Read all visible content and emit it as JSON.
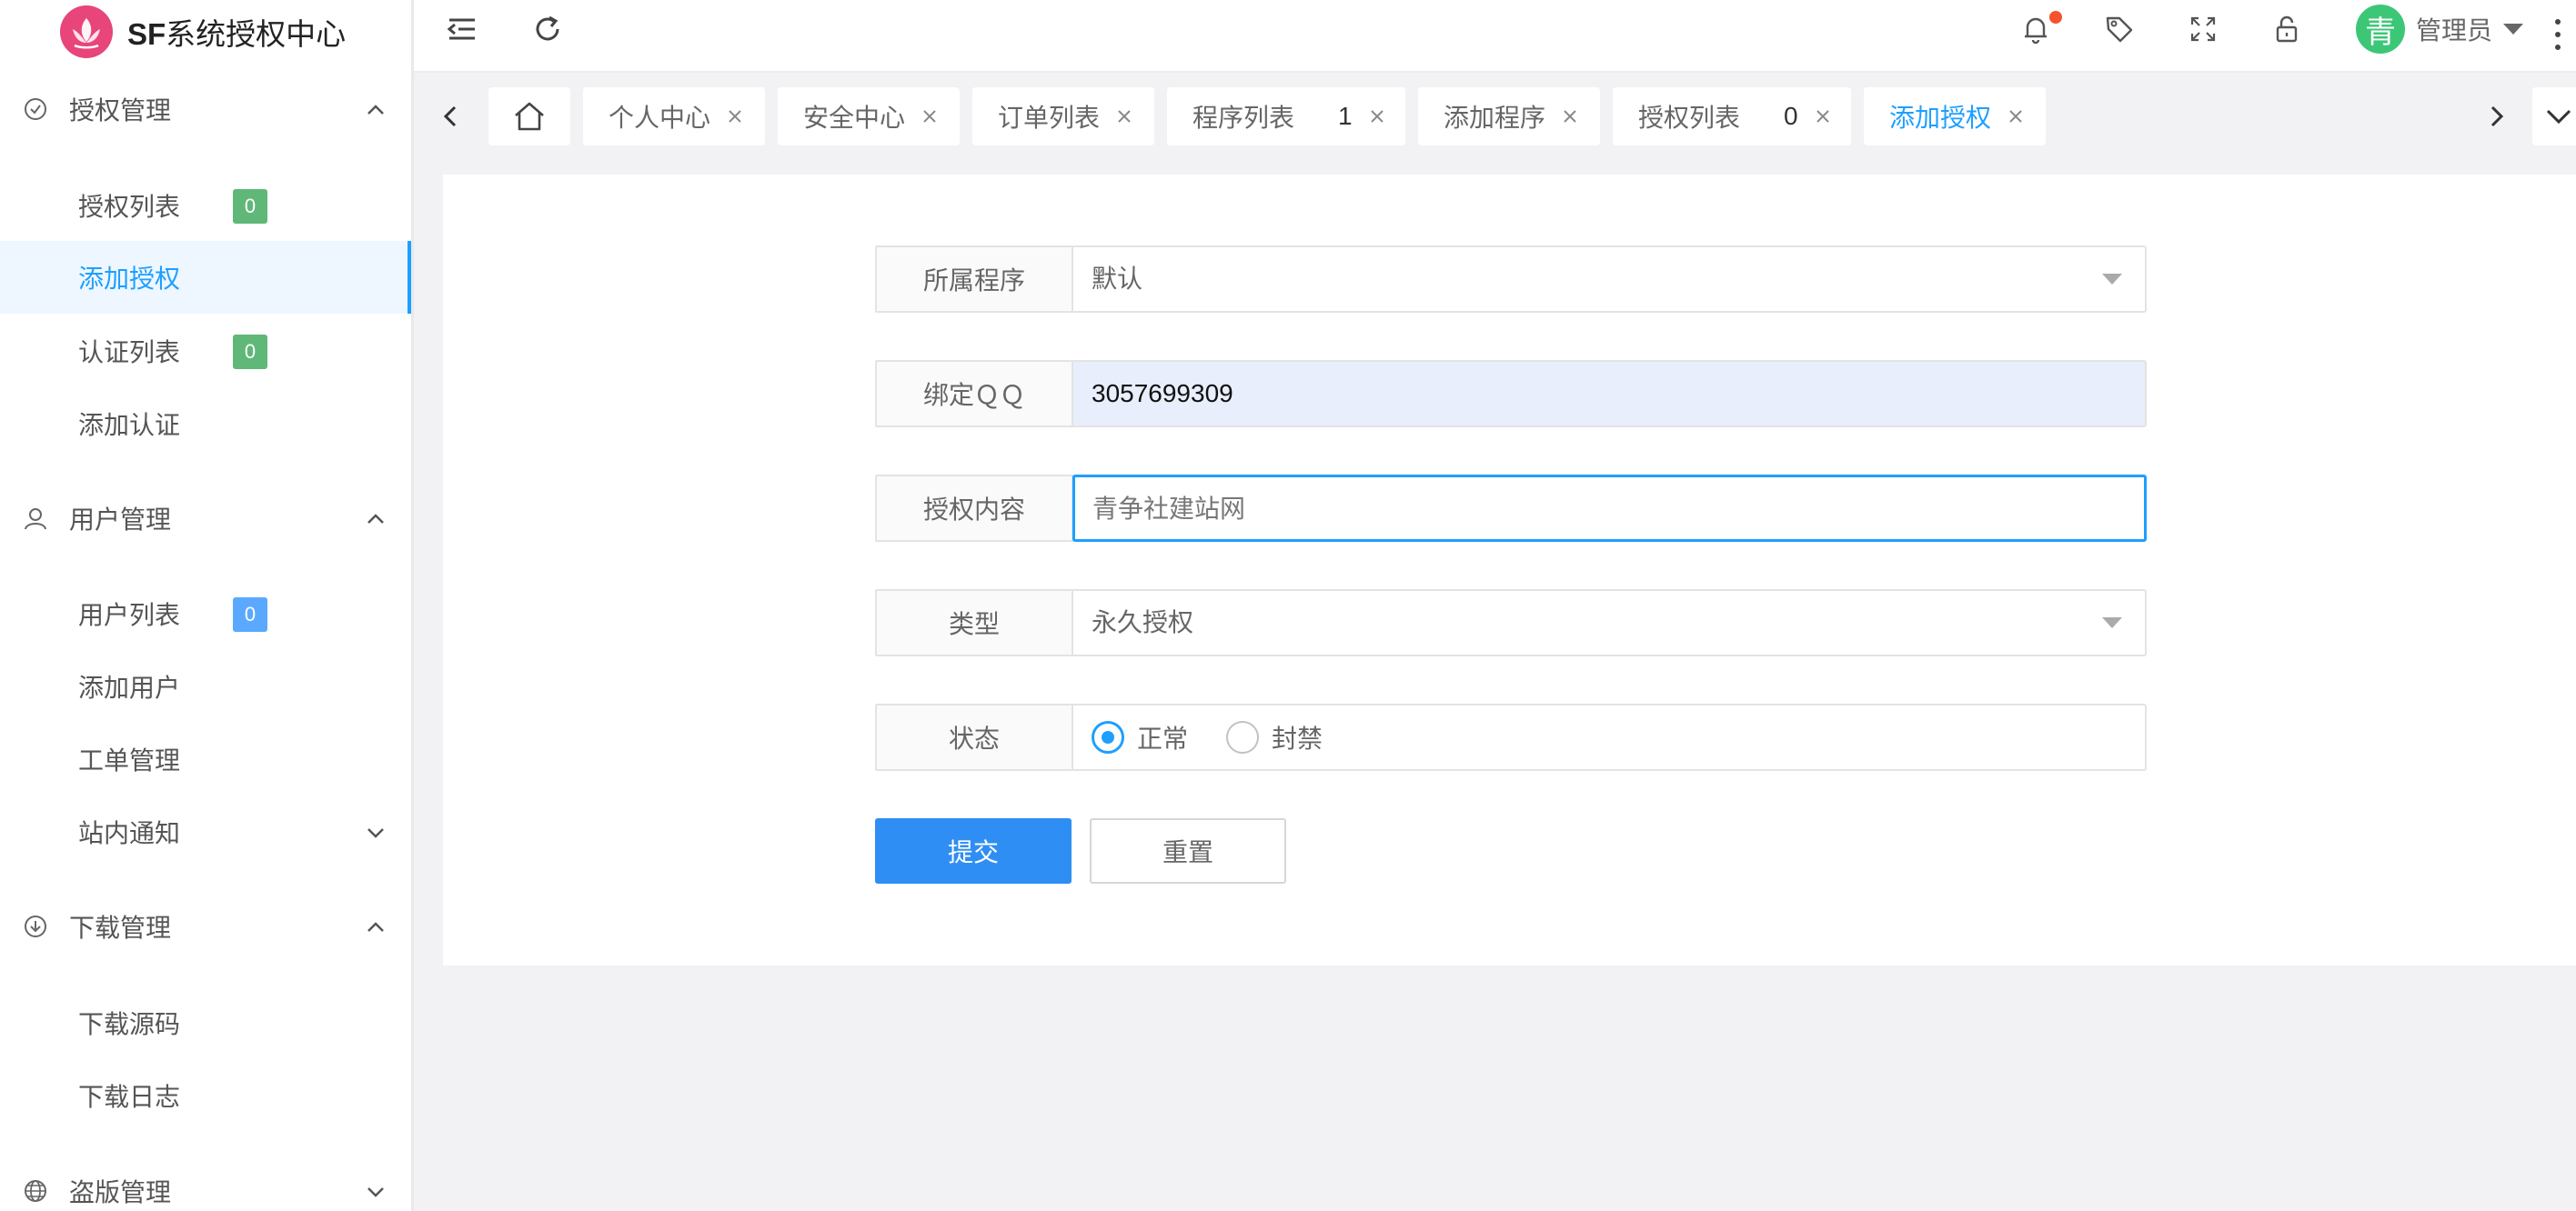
{
  "brand": {
    "prefix": "SF",
    "title": "系统授权中心"
  },
  "sidebar": {
    "groups": [
      {
        "label": "授权管理",
        "icon": "check-circle-icon",
        "expanded": true
      },
      {
        "label": "用户管理",
        "icon": "user-icon",
        "expanded": true
      },
      {
        "label": "下载管理",
        "icon": "download-circle-icon",
        "expanded": true
      },
      {
        "label": "盗版管理",
        "icon": "globe-icon",
        "expanded": false
      }
    ],
    "items": [
      {
        "label": "授权列表",
        "badge": "0",
        "badge_color": "#5fb878"
      },
      {
        "label": "添加授权",
        "active": true
      },
      {
        "label": "认证列表",
        "badge": "0",
        "badge_color": "#5fb878"
      },
      {
        "label": "添加认证"
      },
      {
        "label": "用户列表",
        "badge": "0",
        "badge_color": "#5aa9ff"
      },
      {
        "label": "添加用户"
      },
      {
        "label": "工单管理"
      },
      {
        "label": "站内通知",
        "submenu": true
      },
      {
        "label": "下载源码"
      },
      {
        "label": "下载日志"
      }
    ]
  },
  "header": {
    "icons": [
      "menu-fold-icon",
      "refresh-icon",
      "bell-icon",
      "tag-icon",
      "fullscreen-icon",
      "lock-icon"
    ],
    "user": {
      "avatar_char": "青",
      "name": "管理员"
    }
  },
  "tabs": [
    {
      "label": "",
      "icon": "home-icon"
    },
    {
      "label": "个人中心"
    },
    {
      "label": "安全中心"
    },
    {
      "label": "订单列表"
    },
    {
      "label": "程序列表",
      "badge": "1"
    },
    {
      "label": "添加程序"
    },
    {
      "label": "授权列表",
      "badge": "0"
    },
    {
      "label": "添加授权",
      "active": true
    }
  ],
  "form": {
    "program": {
      "label": "所属程序",
      "value": "默认"
    },
    "qq": {
      "label": "绑定ＱＱ",
      "value": "3057699309"
    },
    "content": {
      "label": "授权内容",
      "placeholder": "青争社建站网"
    },
    "type": {
      "label": "类型",
      "value": "永久授权"
    },
    "status": {
      "label": "状态",
      "options": [
        "正常",
        "封禁"
      ],
      "selected": "正常"
    },
    "submit_label": "提交",
    "reset_label": "重置"
  },
  "colors": {
    "accent": "#1e9fff",
    "primary_button": "#2f8ef3",
    "badge_green": "#5fb878",
    "badge_blue": "#5aa9ff",
    "notification_dot": "#f5522e",
    "avatar": "#3cc777"
  }
}
